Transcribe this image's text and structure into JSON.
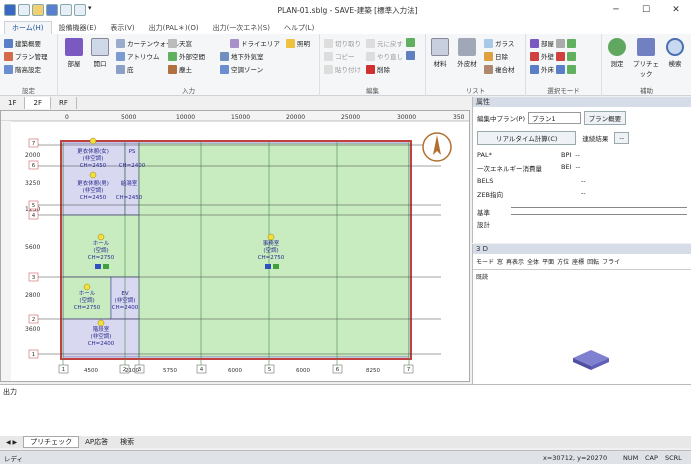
{
  "window": {
    "title": "PLAN-01.sblg - SAVE-建築 [標準入力法]",
    "min": "─",
    "max": "☐",
    "close": "✕"
  },
  "tabs": [
    "ホーム(H)",
    "設備機器(E)",
    "表示(V)",
    "出力(PAL＊)(O)",
    "出力(一次エネ)(S)",
    "ヘルプ(L)"
  ],
  "ribbon": {
    "g1": {
      "label": "設定",
      "items": [
        "建築概要",
        "プラン管理",
        "階高設定"
      ]
    },
    "g2": {
      "label": "入力",
      "big": [
        "部屋",
        "開口"
      ],
      "items": [
        "カーテンウォール",
        "天窓",
        "ドライエリア",
        "照明",
        "アトリウム",
        "外部空間",
        "地下外気室",
        "庇",
        "塵土",
        "空調ゾーン"
      ]
    },
    "g3": {
      "label": "編集",
      "items": [
        "切り取り",
        "元に戻す",
        "コピー",
        "やり直し",
        "貼り付け",
        "削除"
      ]
    },
    "g4": {
      "label": "リスト",
      "items": [
        "材料",
        "外皮材",
        "ガラス",
        "日除",
        "複合材"
      ]
    },
    "g5": {
      "label": "選択モード",
      "items": [
        "部屋",
        "外壁",
        "外床"
      ]
    },
    "g6": {
      "label": "補助",
      "big": [
        "測定",
        "プリチェック",
        "検索"
      ]
    }
  },
  "floors": [
    "1F",
    "2F",
    "RF"
  ],
  "canvas": {
    "ruler_top": [
      "0",
      "5000",
      "10000",
      "15000",
      "20000",
      "25000",
      "30000",
      "350"
    ],
    "row_dims": [
      "2000",
      "3250",
      "1250",
      "5600",
      "2800",
      "3600"
    ],
    "col_dims": [
      "4500",
      "2100",
      "5750",
      "6000",
      "6000",
      "8250"
    ],
    "col_nums": [
      "1",
      "2",
      "3",
      "4",
      "5",
      "6",
      "7"
    ],
    "row_nums": [
      "7",
      "6",
      "5",
      "4",
      "3",
      "2",
      "1"
    ],
    "rooms": [
      {
        "name": "更衣休憩(女)",
        "use": "(非空調)",
        "ch": "CH=2450"
      },
      {
        "name": "PS",
        "use": "(非空調)",
        "ch": "CH=2400"
      },
      {
        "name": "更衣休憩(男)",
        "use": "(非空調)",
        "ch": "CH=2450"
      },
      {
        "name": "給湯室",
        "use": "(非空調)",
        "ch": "CH=2450"
      },
      {
        "name": "ホール",
        "use": "(空調)",
        "ch": "CH=2750"
      },
      {
        "name": "事務室",
        "use": "(空調)",
        "ch": "CH=2750"
      },
      {
        "name": "ホール",
        "use": "(空調)",
        "ch": "CH=2750"
      },
      {
        "name": "EV",
        "use": "(非空調)",
        "ch": "CH=2400"
      },
      {
        "name": "階段室",
        "use": "(非空調)",
        "ch": "CH=2400"
      }
    ]
  },
  "props": {
    "title": "属性",
    "plan_label": "編集中プラン(P)",
    "plan_value": "プラン1",
    "plan_btn": "プラン概要",
    "calc_btn": "リアルタイム計算(C)",
    "calc_result": "連続結果",
    "pal_label": "PAL*",
    "bpi": "BPI",
    "ene_label": "一次エネルギー消費量",
    "bei": "BEI",
    "bels": "BELS",
    "zeb": "ZEB指向",
    "kijun": "基準",
    "sekkei": "設計",
    "dash": "--"
  },
  "view3d": {
    "title": "3 D",
    "tools": [
      "モード",
      "窓",
      "再表示",
      "全体",
      "平面",
      "方位",
      "座標",
      "回転",
      "フライ"
    ],
    "label": "既読"
  },
  "output": {
    "title": "出力"
  },
  "sheets": [
    "プリチェック",
    "AP応答",
    "検索"
  ],
  "status": {
    "left": "レディ",
    "coords": "x=30712, y=20270",
    "num": "NUM",
    "cap": "CAP",
    "scrl": "SCRL"
  }
}
